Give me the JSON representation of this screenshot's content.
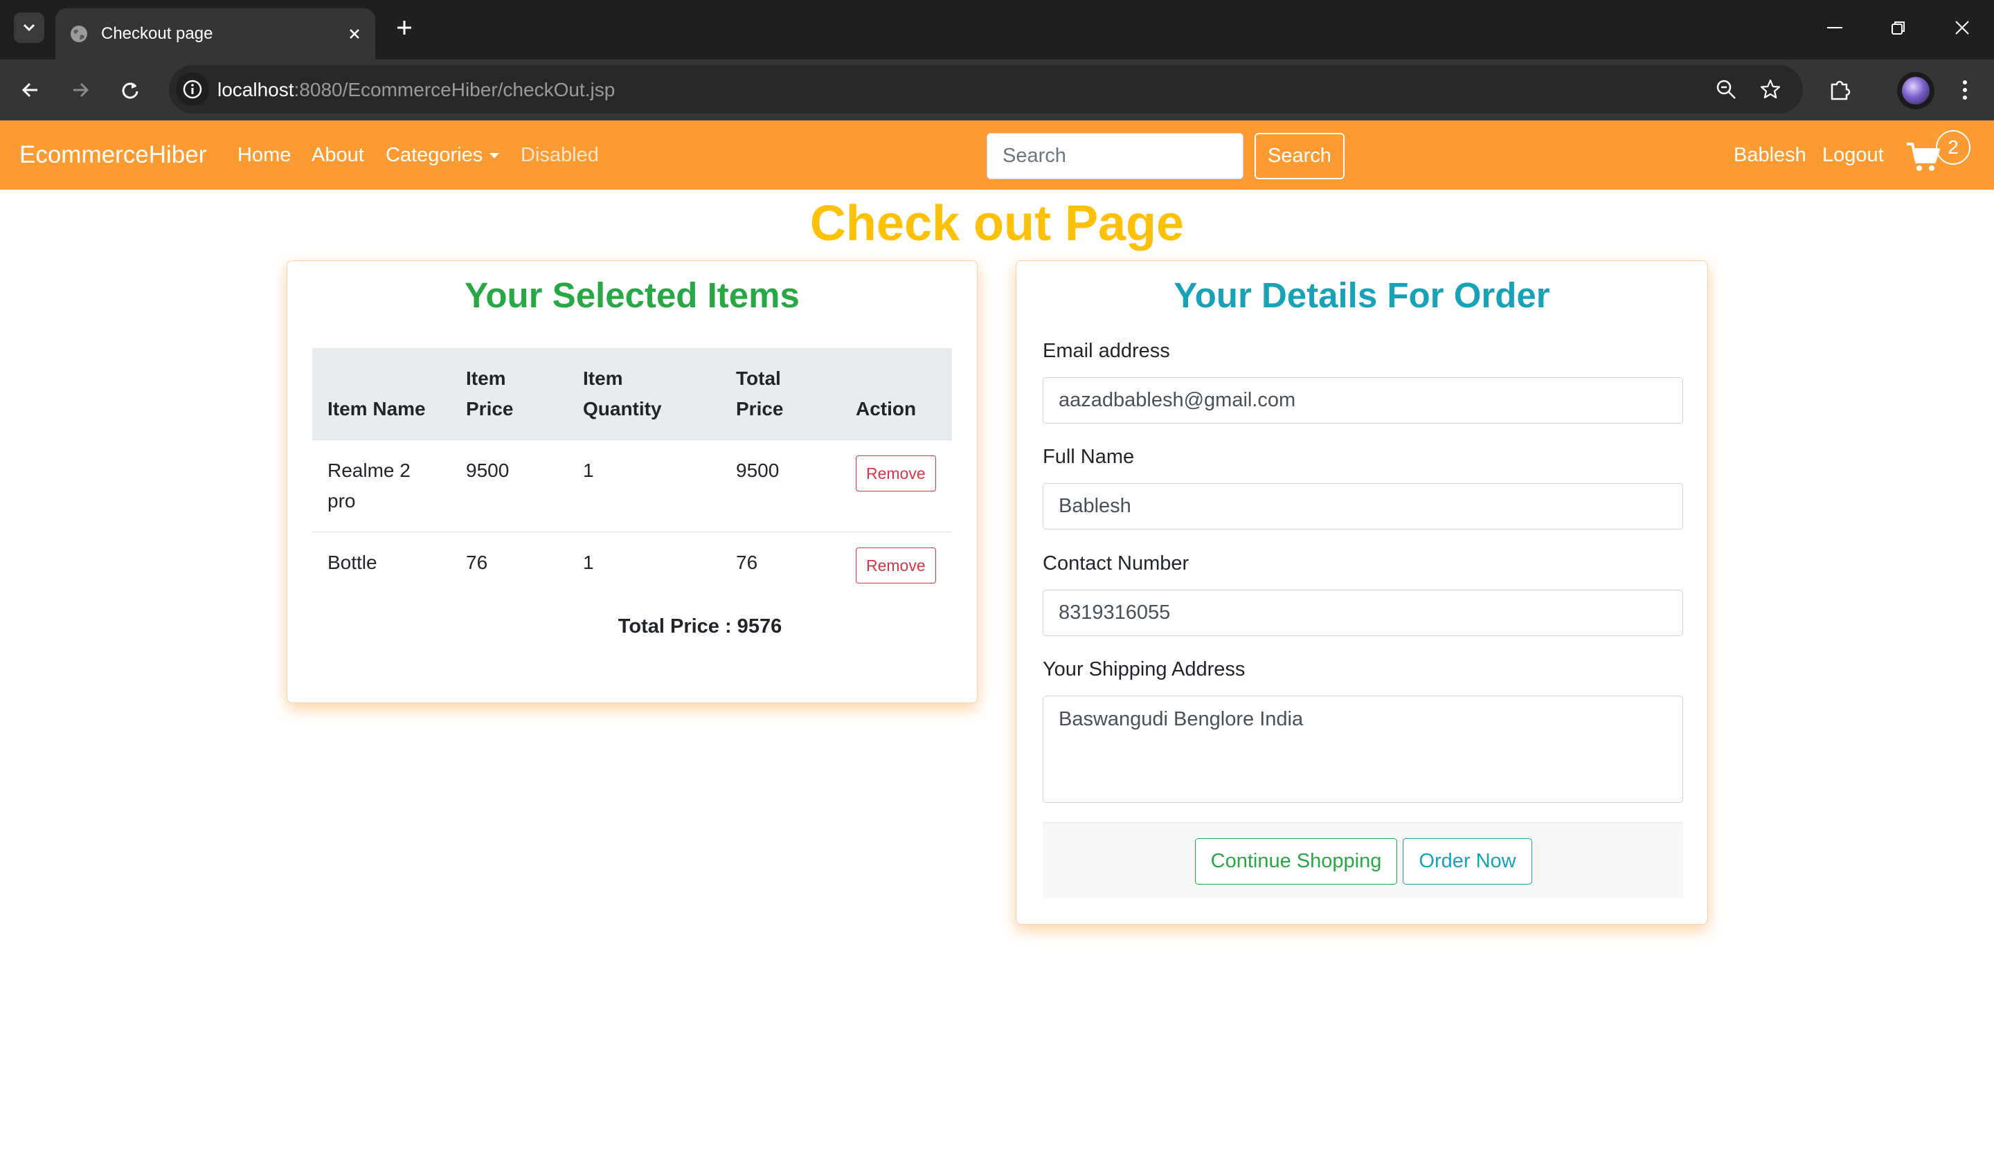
{
  "browser": {
    "tab_title": "Checkout page",
    "url_host": "localhost",
    "url_rest": ":8080/EcommerceHiber/checkOut.jsp"
  },
  "navbar": {
    "brand": "EcommerceHiber",
    "links": [
      "Home",
      "About",
      "Categories",
      "Disabled"
    ],
    "search_placeholder": "Search",
    "search_button": "Search",
    "user": "Bablesh",
    "logout": "Logout",
    "cart_count": "2",
    "color": "#fd9b33"
  },
  "page": {
    "title": "Check out Page"
  },
  "cart_card": {
    "heading": "Your Selected Items",
    "columns": [
      "Item Name",
      "Item Price",
      "Item Quantity",
      "Total Price",
      "Action"
    ],
    "rows": [
      {
        "name": "Realme 2 pro",
        "price": "9500",
        "quantity": "1",
        "total": "9500",
        "action": "Remove"
      },
      {
        "name": "Bottle",
        "price": "76",
        "quantity": "1",
        "total": "76",
        "action": "Remove"
      }
    ],
    "total_label": "Total Price : 9576"
  },
  "order_card": {
    "heading": "Your Details For Order",
    "email_label": "Email address",
    "email_value": "aazadbablesh@gmail.com",
    "name_label": "Full Name",
    "name_value": "Bablesh",
    "contact_label": "Contact Number",
    "contact_value": "8319316055",
    "address_label": "Your Shipping Address",
    "address_value": "Baswangudi Benglore India",
    "continue_button": "Continue Shopping",
    "order_button": "Order Now"
  }
}
